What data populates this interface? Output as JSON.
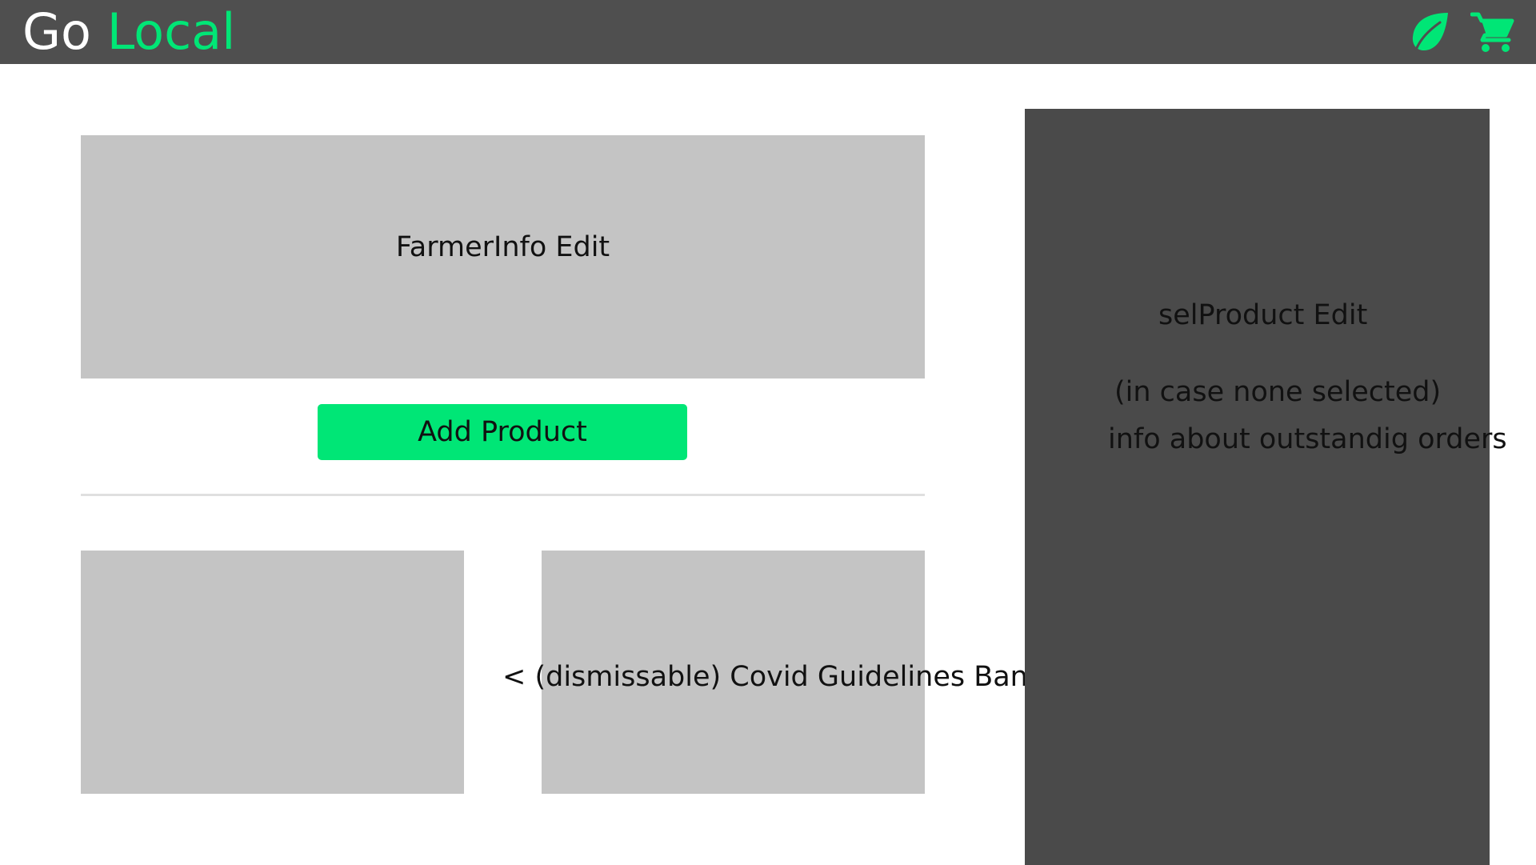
{
  "header": {
    "brand_first": "Go",
    "brand_second": "Local",
    "icons": [
      "leaf-icon",
      "cart-icon"
    ]
  },
  "colors": {
    "header_bg": "#4f4f4f",
    "accent": "#00e676",
    "placeholder_bg": "#c4c4c4",
    "panel_bg": "#4a4a4a"
  },
  "main": {
    "farmer_info_label": "FarmerInfo Edit",
    "add_product_label": "Add Product",
    "covid_banner_text": "< (dismissable) Covid Guidelines Banner>"
  },
  "side_panel": {
    "title": "selProduct Edit",
    "note": "(in case none selected)",
    "info": "info about outstandig orders"
  }
}
